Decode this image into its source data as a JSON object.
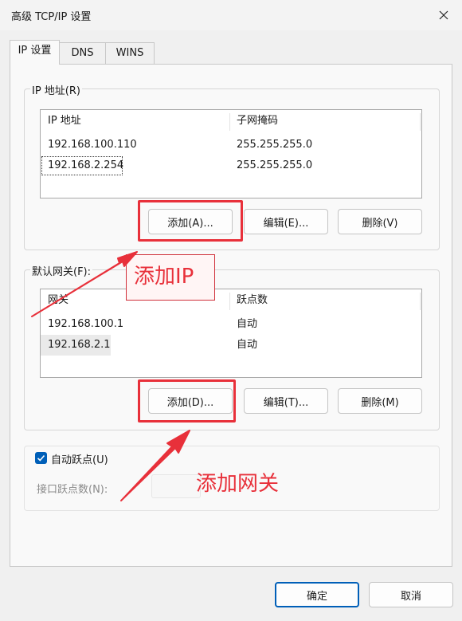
{
  "window": {
    "title": "高级 TCP/IP 设置"
  },
  "tabs": [
    "IP 设置",
    "DNS",
    "WINS"
  ],
  "ip_group": {
    "label": "IP 地址(R)",
    "columns": [
      "IP 地址",
      "子网掩码"
    ],
    "rows": [
      [
        "192.168.100.110",
        "255.255.255.0"
      ],
      [
        "192.168.2.254",
        "255.255.255.0"
      ]
    ],
    "buttons": {
      "add": "添加(A)...",
      "edit": "编辑(E)...",
      "delete": "删除(V)"
    }
  },
  "gateway_group": {
    "label": "默认网关(F):",
    "columns": [
      "网关",
      "跃点数"
    ],
    "rows": [
      [
        "192.168.100.1",
        "自动"
      ],
      [
        "192.168.2.1",
        "自动"
      ]
    ],
    "buttons": {
      "add": "添加(D)...",
      "edit": "编辑(T)...",
      "delete": "删除(M)"
    }
  },
  "auto_metric": {
    "label": "自动跃点(U)",
    "checked": true
  },
  "interface_metric": {
    "label": "接口跃点数(N):",
    "value": ""
  },
  "footer": {
    "ok": "确定",
    "cancel": "取消"
  },
  "annotations": {
    "add_ip": "添加IP",
    "add_gateway": "添加网关"
  },
  "colors": {
    "accent": "#005fb8",
    "annotation": "#e8303a"
  }
}
